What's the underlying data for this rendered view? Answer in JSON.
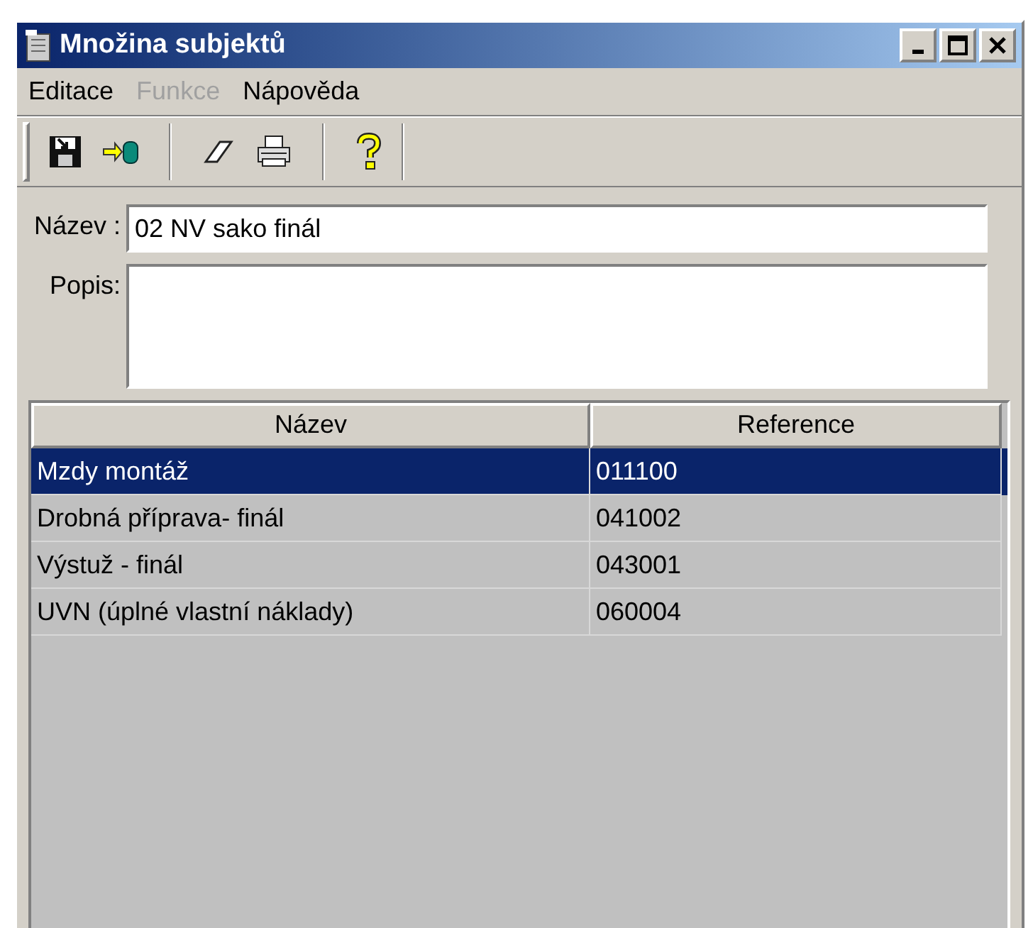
{
  "window": {
    "title": "Množina subjektů"
  },
  "menu": [
    {
      "label": "Editace",
      "disabled": false
    },
    {
      "label": "Funkce",
      "disabled": true
    },
    {
      "label": "Nápověda",
      "disabled": false
    }
  ],
  "toolbar": [
    {
      "kind": "save"
    },
    {
      "kind": "import"
    },
    {
      "kind": "sep"
    },
    {
      "kind": "eraser"
    },
    {
      "kind": "print"
    },
    {
      "kind": "sep"
    },
    {
      "kind": "help"
    }
  ],
  "form": {
    "name_label": "Název :",
    "name_value": "02 NV sako finál",
    "description_label": "Popis:"
  },
  "table": {
    "columns": [
      "Název",
      "Reference"
    ],
    "rows": [
      {
        "cells": [
          "Mzdy montáž",
          "011100"
        ],
        "selected": true
      },
      {
        "cells": [
          "Drobná příprava- finál",
          "041002"
        ],
        "selected": false
      },
      {
        "cells": [
          "Výstuž - finál",
          "043001"
        ],
        "selected": false
      },
      {
        "cells": [
          "UVN (úplné vlastní náklady)",
          "060004"
        ],
        "selected": false
      }
    ]
  }
}
